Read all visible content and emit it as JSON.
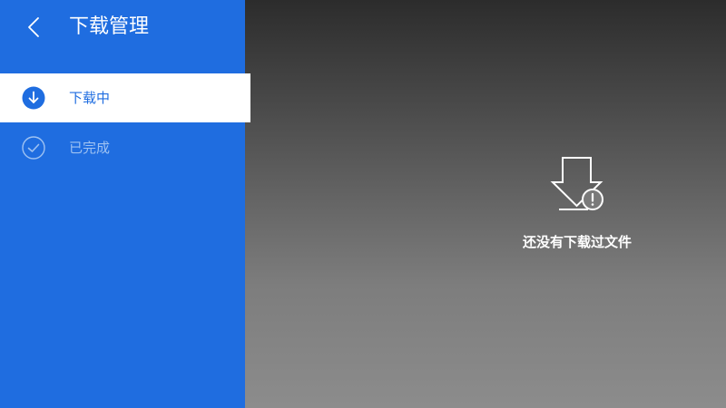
{
  "header": {
    "title": "下载管理",
    "back_icon": "chevron-left-icon"
  },
  "sidebar": {
    "items": [
      {
        "label": "下载中",
        "icon": "download-circle-icon",
        "active": true
      },
      {
        "label": "已完成",
        "icon": "check-circle-icon",
        "active": false
      }
    ]
  },
  "main": {
    "empty_icon": "download-warning-icon",
    "empty_text": "还没有下载过文件"
  },
  "colors": {
    "accent": "#1f6de0",
    "active_bg": "#ffffff",
    "inactive_label": "#9ec2f2"
  }
}
